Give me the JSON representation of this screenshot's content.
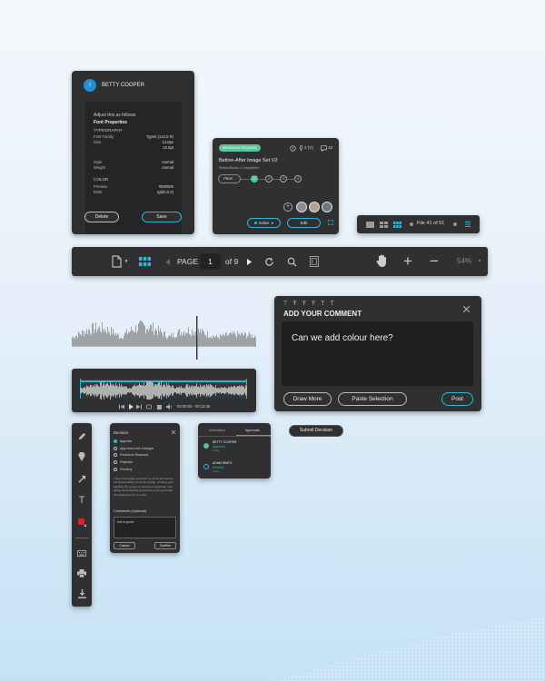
{
  "font_panel": {
    "user_initial": "I",
    "user_name": "BETTY COOPER",
    "adjust_text": "Adjust this as follows",
    "section_title": "Font Properties",
    "typography_label": "TYPOGRAPHY",
    "rows_a": [
      {
        "label": "Font Family",
        "value": "Type/I (142.5 R)"
      },
      {
        "label": "Size",
        "value": "14.8px"
      },
      {
        "label": "",
        "value": "10.5pt"
      }
    ],
    "rows_b": [
      {
        "label": "Style",
        "value": "normal"
      },
      {
        "label": "Weight",
        "value": "normal"
      }
    ],
    "color_label": "COLOR",
    "rows_c": [
      {
        "label": "Preview",
        "value": "#000000"
      },
      {
        "label": "RGB",
        "value": "rgb(0,0,0)"
      }
    ],
    "delete_label": "Delete",
    "save_label": "Save"
  },
  "review_card": {
    "badge": "REVIEWING REQUIRED",
    "versions": "2 (V)",
    "comments": "13",
    "title": "Before-After Image Set V2",
    "subtitle": "ReviewStudio • Unspecified",
    "stage_label": "PROF...",
    "steps": [
      "1",
      "2",
      "3",
      "4"
    ],
    "status_label": "Active",
    "edit_label": "Edit"
  },
  "file_nav": {
    "text": "File 41 of 51"
  },
  "doc_toolbar": {
    "page_label": "PAGE",
    "page_value": "1",
    "of_label": "of 9",
    "zoom": "54%"
  },
  "comment_box": {
    "title": "ADD YOUR COMMENT",
    "text": "Can we add colour here?",
    "draw_more": "Draw More",
    "paste_selection": "Paste Selection",
    "post": "Post"
  },
  "audio_player": {
    "time": "00:00:05 - 00:12:45"
  },
  "decision_panel": {
    "title": "Decision",
    "options": [
      "Approve",
      "Approved with changes",
      "Revisions Required",
      "Rejected",
      "Pending"
    ],
    "disclaimer": "I have thoroughly reviewed my proof and accept full responsibility for all the design, wording, and legibility. By giving my final proof approval, I am giving Reviewstudio permission to proceed with the production of my order.",
    "comments_label": "Comments (Optional)",
    "comments_value": "this is great",
    "cancel": "Cancel",
    "confirm": "Confirm"
  },
  "submit_decision": {
    "label": "Submit Decision"
  },
  "approval_panel": {
    "tab_info": "Information",
    "tab_approvals": "Approvals",
    "people": [
      {
        "name": "BETTY COOPER",
        "status": "Approved",
        "time": "Today"
      },
      {
        "name": "ADAM SMITH",
        "status": "Pending...",
        "time": "Today"
      }
    ]
  },
  "colors": {
    "panel": "#303032",
    "accent_teal": "#2bb6d8",
    "accent_green": "#5bc39a",
    "draw_red": "#e02020"
  }
}
